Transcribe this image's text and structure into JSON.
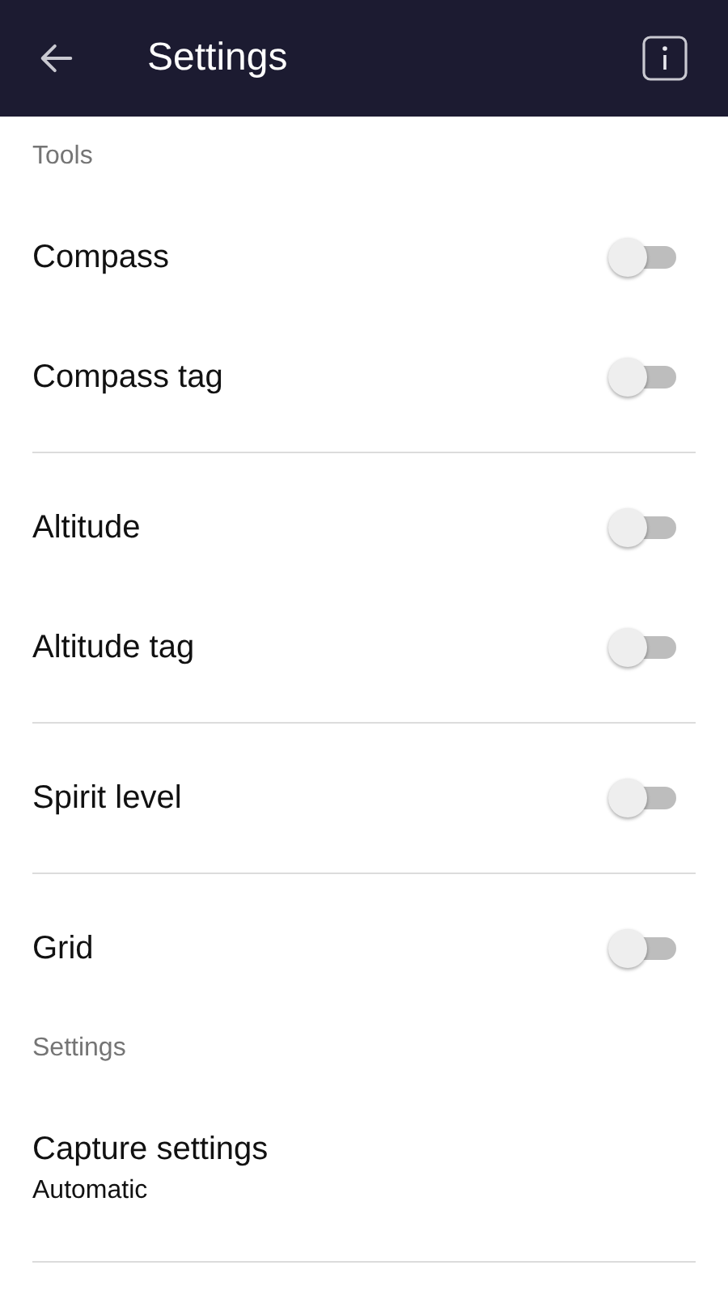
{
  "app_bar": {
    "title": "Settings"
  },
  "sections": [
    {
      "title": "Tools",
      "items": [
        {
          "kind": "toggle",
          "label": "Compass",
          "on": false,
          "divider_after": false
        },
        {
          "kind": "toggle",
          "label": "Compass tag",
          "on": false,
          "divider_after": true
        },
        {
          "kind": "toggle",
          "label": "Altitude",
          "on": false,
          "divider_after": false
        },
        {
          "kind": "toggle",
          "label": "Altitude tag",
          "on": false,
          "divider_after": true
        },
        {
          "kind": "toggle",
          "label": "Spirit level",
          "on": false,
          "divider_after": true
        },
        {
          "kind": "toggle",
          "label": "Grid",
          "on": false,
          "divider_after": false
        }
      ]
    },
    {
      "title": "Settings",
      "items": [
        {
          "kind": "value",
          "label": "Capture settings",
          "value": "Automatic",
          "divider_after": true
        }
      ]
    }
  ]
}
